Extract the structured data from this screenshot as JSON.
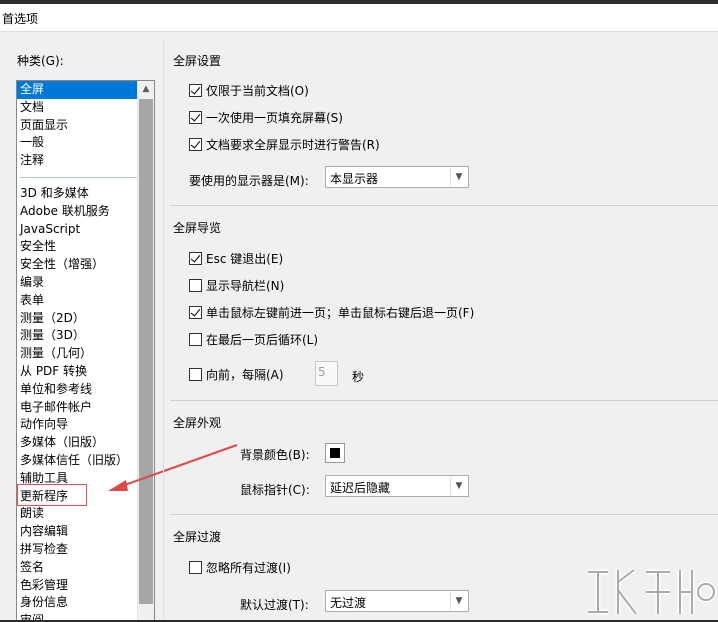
{
  "window": {
    "title": "首选项"
  },
  "categories": {
    "label": "种类(G):",
    "group1": [
      "全屏",
      "文档",
      "页面显示",
      "一般",
      "注释"
    ],
    "group2": [
      "3D 和多媒体",
      "Adobe 联机服务",
      "JavaScript",
      "安全性",
      "安全性（增强）",
      "编录",
      "表单",
      "测量（2D）",
      "测量（3D）",
      "测量（几何）",
      "从 PDF 转换",
      "单位和参考线",
      "电子邮件帐户",
      "动作向导",
      "多媒体（旧版）",
      "多媒体信任（旧版）",
      "辅助工具",
      "更新程序",
      "朗读",
      "内容编辑",
      "拼写检查",
      "签名",
      "色彩管理",
      "身份信息",
      "审阅"
    ],
    "selected": "全屏",
    "highlighted": "更新程序"
  },
  "fullscreen_setup": {
    "title": "全屏设置",
    "current_doc_only": "仅限于当前文档(O)",
    "fill_screen": "一次使用一页填充屏幕(S)",
    "warn_doc": "文档要求全屏显示时进行警告(R)",
    "monitor_label": "要使用的显示器是(M):",
    "monitor_value": "本显示器"
  },
  "fullscreen_nav": {
    "title": "全屏导览",
    "esc_exit": "Esc 键退出(E)",
    "show_nav": "显示导航栏(N)",
    "click_advance": "单击鼠标左键前进一页；单击鼠标右键后退一页(F)",
    "loop": "在最后一页后循环(L)",
    "advance_every": "向前，每隔(A)",
    "interval_value": "5",
    "seconds": "秒"
  },
  "fullscreen_appearance": {
    "title": "全屏外观",
    "bg_color_label": "背景颜色(B):",
    "bg_color": "#000000",
    "cursor_label": "鼠标指针(C):",
    "cursor_value": "延迟后隐藏"
  },
  "fullscreen_transition": {
    "title": "全屏过渡",
    "ignore_all": "忽略所有过渡(I)",
    "default_label": "默认过渡(T):",
    "default_value": "无过渡"
  },
  "colors": {
    "selection": "#0078d7",
    "annotation": "#e04848"
  },
  "icons": [
    "check-icon",
    "scroll-up-arrow-icon",
    "dropdown-arrow-icon",
    "annotation-arrow-icon",
    "watermark-logo"
  ]
}
